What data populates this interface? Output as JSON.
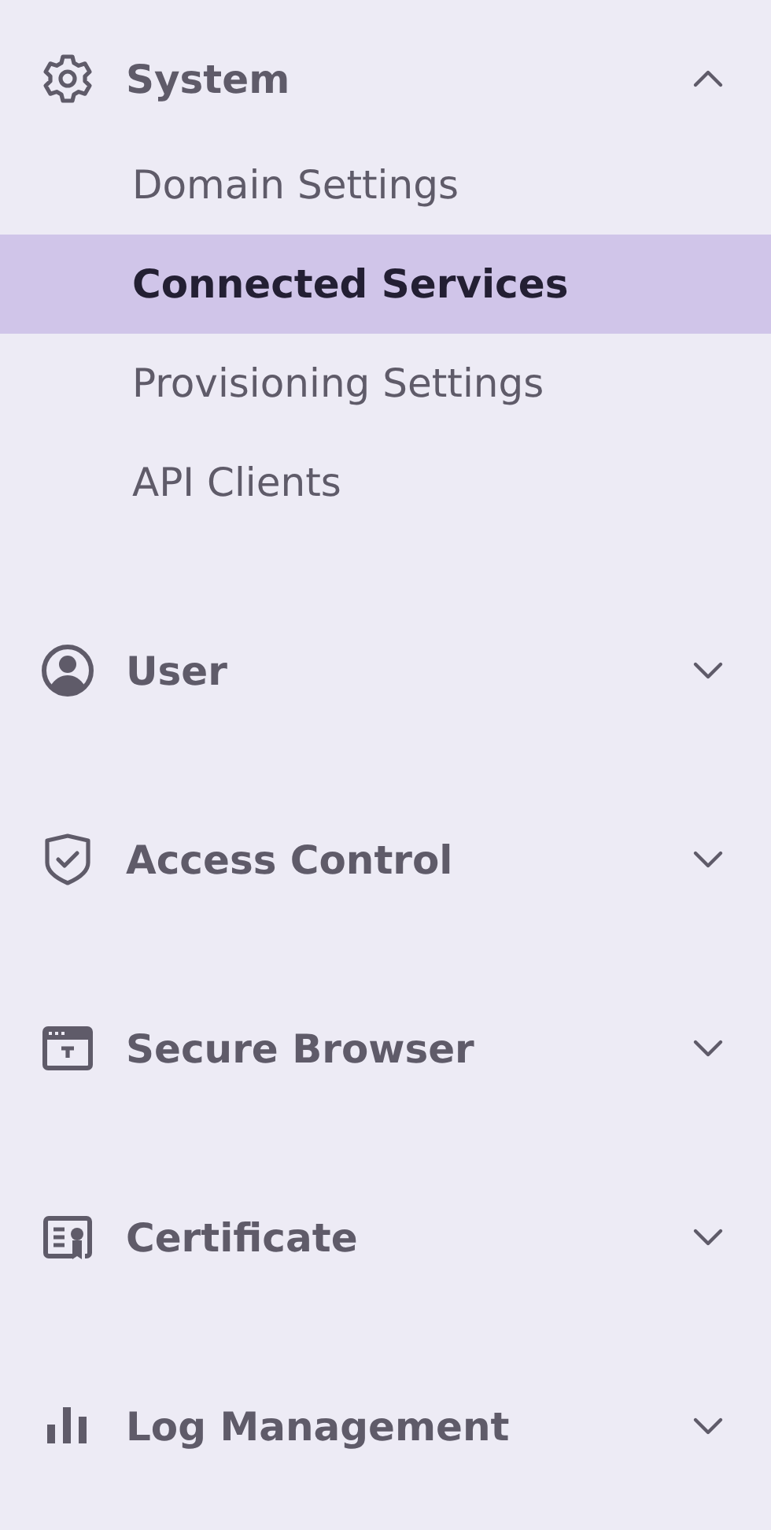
{
  "sidebar": {
    "sections": [
      {
        "label": "System",
        "expanded": true,
        "items": [
          {
            "label": "Domain Settings",
            "selected": false
          },
          {
            "label": "Connected Services",
            "selected": true
          },
          {
            "label": "Provisioning Settings",
            "selected": false
          },
          {
            "label": "API Clients",
            "selected": false
          }
        ]
      },
      {
        "label": "User",
        "expanded": false
      },
      {
        "label": "Access Control",
        "expanded": false
      },
      {
        "label": "Secure Browser",
        "expanded": false
      },
      {
        "label": "Certificate",
        "expanded": false
      },
      {
        "label": "Log Management",
        "expanded": false
      }
    ]
  }
}
